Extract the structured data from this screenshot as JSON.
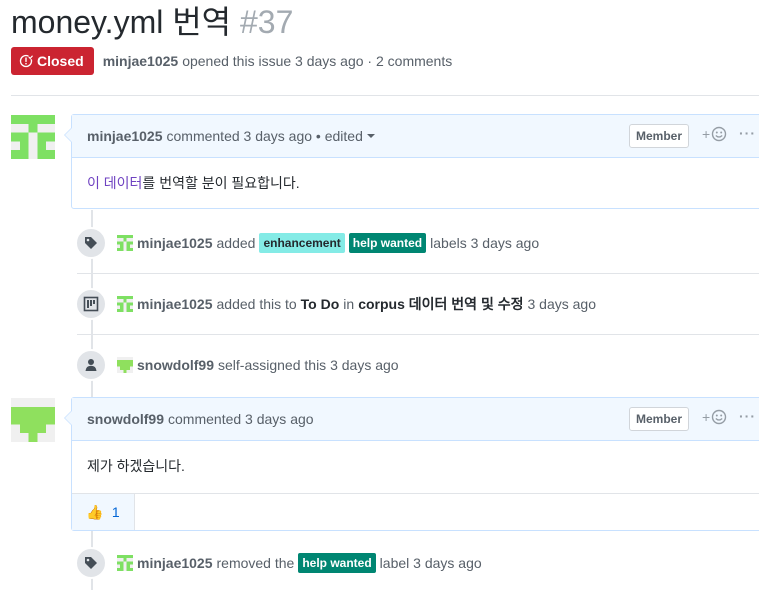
{
  "issue": {
    "title": "money.yml 번역",
    "number": "#37",
    "state": "Closed",
    "author": "minjae1025",
    "opened_text": "opened this issue 3 days ago · 2 comments"
  },
  "colors": {
    "closed": "#cb2431",
    "enhancement": "#84ebe6",
    "help_wanted": "#008672",
    "link": "#6f42c1"
  },
  "comments": [
    {
      "author": "minjae1025",
      "meta": "commented 3 days ago • edited",
      "badge": "Member",
      "reaction_button": "+",
      "more": "···",
      "body_link": "이 데이터",
      "body_rest": "를 번역할 분이 필요합니다."
    },
    {
      "author": "snowdolf99",
      "meta": "commented 3 days ago",
      "badge": "Member",
      "reaction_button": "+",
      "more": "···",
      "body": "제가 하겠습니다.",
      "reactions": [
        {
          "emoji": "👍",
          "count": "1"
        }
      ]
    }
  ],
  "events": [
    {
      "icon": "tag-icon",
      "actor": "minjae1025",
      "action": "added",
      "labels": [
        "enhancement",
        "help wanted"
      ],
      "tail": "labels 3 days ago"
    },
    {
      "icon": "project-icon",
      "actor": "minjae1025",
      "action": "added this to",
      "column": "To Do",
      "joiner": "in",
      "project": "corpus 데이터 번역 및 수정",
      "time": "3 days ago"
    },
    {
      "icon": "person-icon",
      "actor": "snowdolf99",
      "action": "self-assigned this 3 days ago"
    },
    {
      "icon": "tag-icon",
      "actor": "minjae1025",
      "action": "removed the",
      "label": "help wanted",
      "tail": "label 3 days ago"
    }
  ]
}
